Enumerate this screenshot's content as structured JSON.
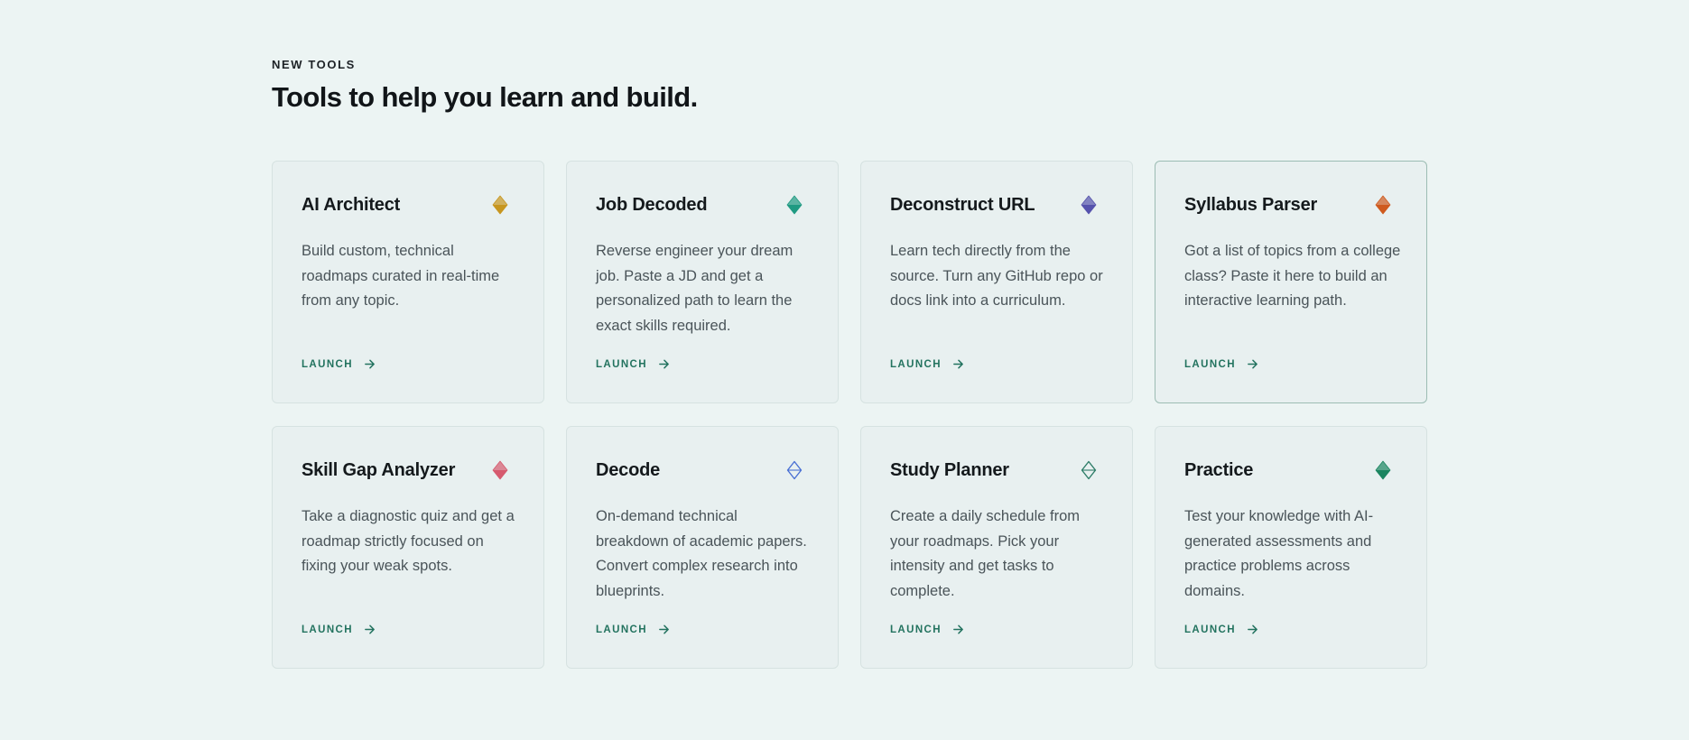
{
  "section": {
    "eyebrow": "NEW TOOLS",
    "title": "Tools to help you learn and build."
  },
  "accent_color": "#23735f",
  "tools": [
    {
      "title": "AI Architect",
      "description": "Build custom, technical roadmaps curated in real-time from any topic.",
      "launch_label": "LAUNCH",
      "icon": "diamond-icon",
      "icon_color": "#c7961f",
      "icon_style": "filled"
    },
    {
      "title": "Job Decoded",
      "description": "Reverse engineer your dream job. Paste a JD and get a personalized path to learn the exact skills required.",
      "launch_label": "LAUNCH",
      "icon": "diamond-icon",
      "icon_color": "#1f9a82",
      "icon_style": "filled"
    },
    {
      "title": "Deconstruct URL",
      "description": "Learn tech directly from the source. Turn any GitHub repo or docs link into a curriculum.",
      "launch_label": "LAUNCH",
      "icon": "diamond-icon",
      "icon_color": "#5552ad",
      "icon_style": "filled"
    },
    {
      "title": "Syllabus Parser",
      "description": "Got a list of topics from a college class? Paste it here to build an interactive learning path.",
      "launch_label": "LAUNCH",
      "icon": "diamond-icon",
      "icon_color": "#cf5a1e",
      "icon_style": "filled"
    },
    {
      "title": "Skill Gap Analyzer",
      "description": "Take a diagnostic quiz and get a roadmap strictly focused on fixing your weak spots.",
      "launch_label": "LAUNCH",
      "icon": "diamond-icon",
      "icon_color": "#d65a6e",
      "icon_style": "filled"
    },
    {
      "title": "Decode",
      "description": "On-demand technical breakdown of academic papers. Convert complex research into blueprints.",
      "launch_label": "LAUNCH",
      "icon": "diamond-outline-icon",
      "icon_color": "#4a70d4",
      "icon_style": "outline"
    },
    {
      "title": "Study Planner",
      "description": "Create a daily schedule from your roadmaps. Pick your intensity and get tasks to complete.",
      "launch_label": "LAUNCH",
      "icon": "diamond-outline-icon",
      "icon_color": "#2e7d68",
      "icon_style": "outline"
    },
    {
      "title": "Practice",
      "description": "Test your knowledge with AI-generated assessments and practice problems across domains.",
      "launch_label": "LAUNCH",
      "icon": "diamond-icon",
      "icon_color": "#1b8560",
      "icon_style": "filled"
    }
  ]
}
